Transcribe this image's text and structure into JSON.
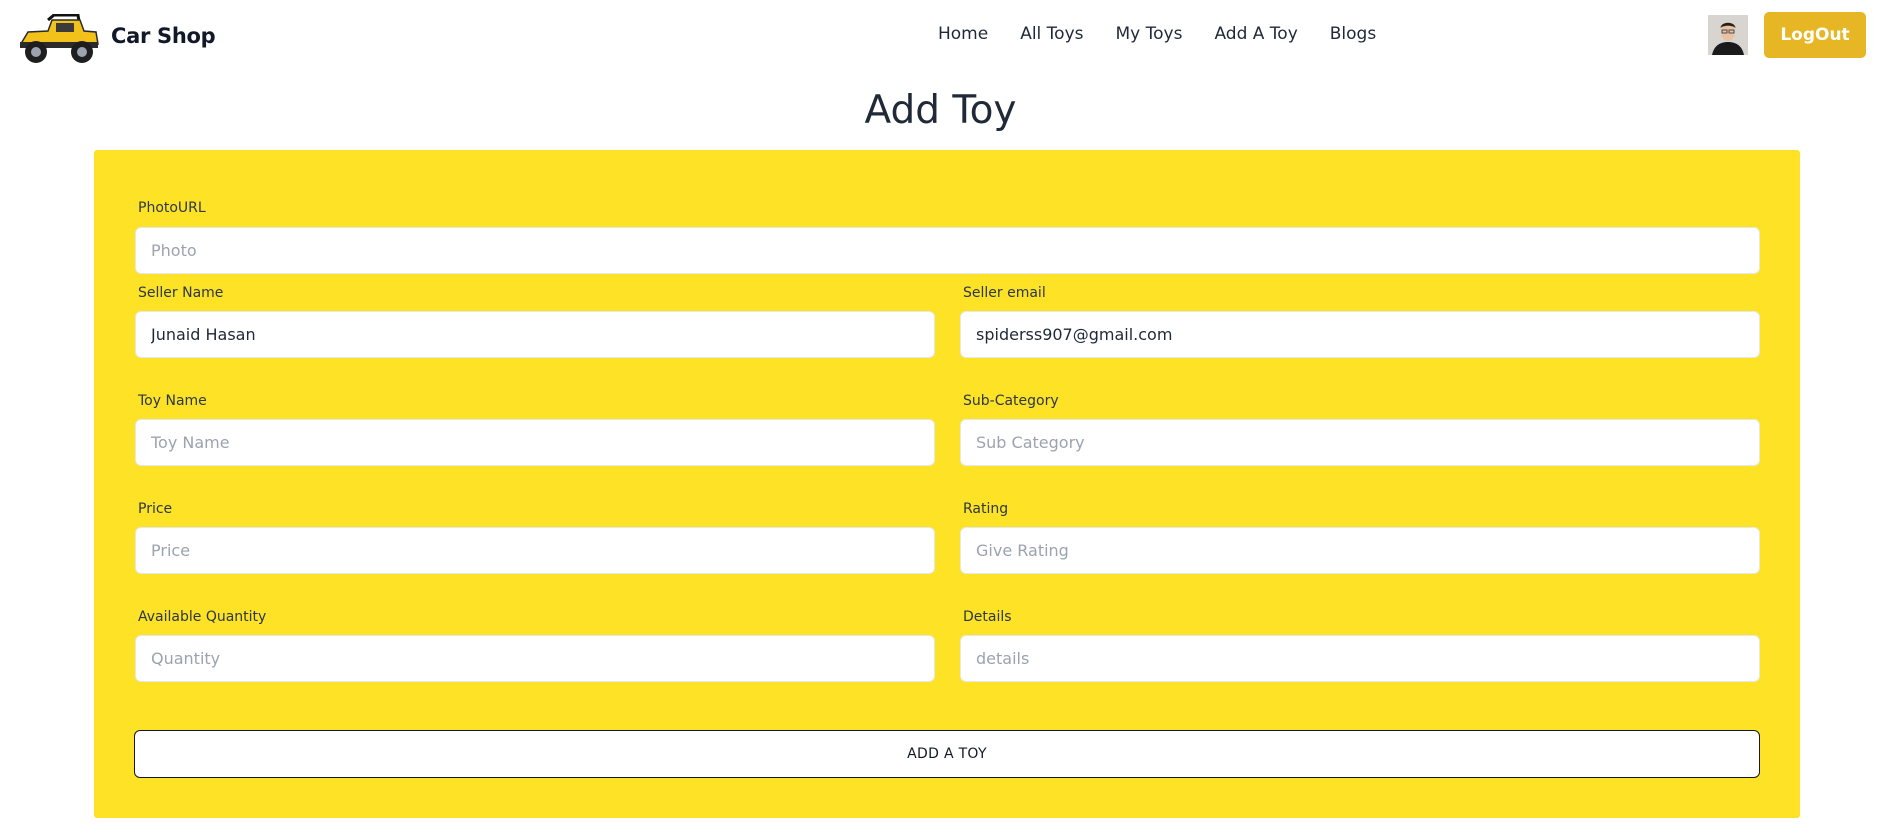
{
  "brand": {
    "name": "Car Shop"
  },
  "nav": {
    "items": [
      "Home",
      "All Toys",
      "My Toys",
      "Add A Toy",
      "Blogs"
    ]
  },
  "header": {
    "logout_label": "LogOut"
  },
  "page": {
    "title": "Add Toy"
  },
  "form": {
    "photo": {
      "label": "PhotoURL",
      "placeholder": "Photo",
      "value": ""
    },
    "seller_name": {
      "label": "Seller Name",
      "placeholder": "",
      "value": "Junaid Hasan"
    },
    "seller_email": {
      "label": "Seller email",
      "placeholder": "",
      "value": "spiderss907@gmail.com"
    },
    "toy_name": {
      "label": "Toy Name",
      "placeholder": "Toy Name",
      "value": ""
    },
    "sub_category": {
      "label": "Sub-Category",
      "placeholder": "Sub Category",
      "value": ""
    },
    "price": {
      "label": "Price",
      "placeholder": "Price",
      "value": ""
    },
    "rating": {
      "label": "Rating",
      "placeholder": "Give Rating",
      "value": ""
    },
    "quantity": {
      "label": "Available Quantity",
      "placeholder": "Quantity",
      "value": ""
    },
    "details": {
      "label": "Details",
      "placeholder": "details",
      "value": ""
    },
    "submit_label": "ADD A TOY"
  },
  "colors": {
    "panel": "#fde225",
    "logout_button": "#e6b625"
  },
  "icons": {
    "logo": "toy-jeep-logo-icon",
    "avatar": "user-avatar"
  }
}
